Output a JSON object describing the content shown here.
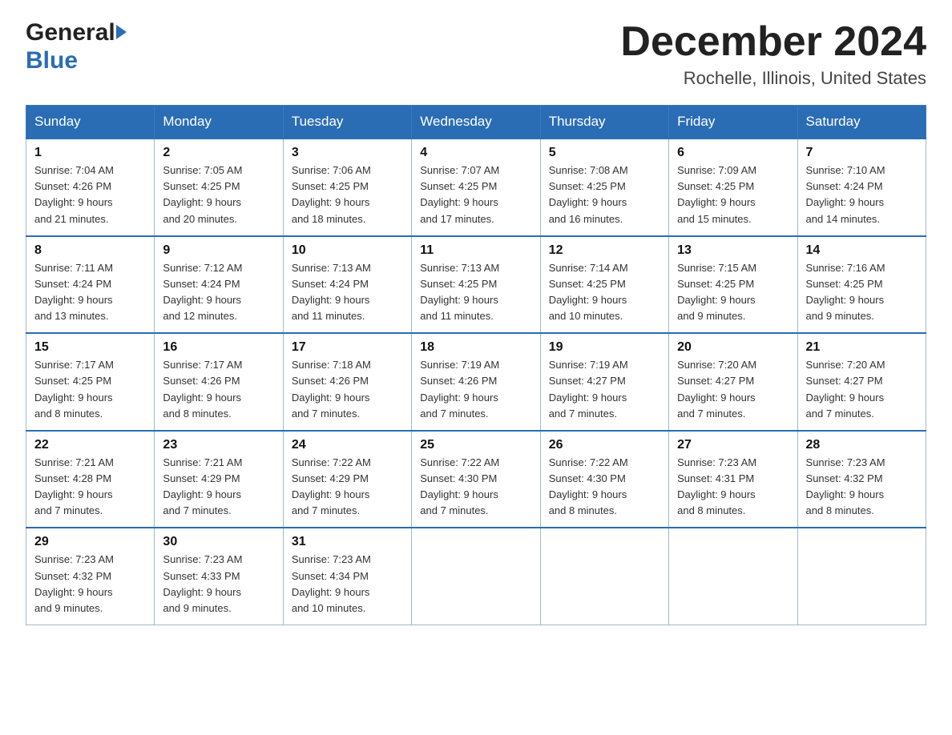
{
  "header": {
    "logo_general": "General",
    "logo_blue": "Blue",
    "month_title": "December 2024",
    "location": "Rochelle, Illinois, United States"
  },
  "days_of_week": [
    "Sunday",
    "Monday",
    "Tuesday",
    "Wednesday",
    "Thursday",
    "Friday",
    "Saturday"
  ],
  "weeks": [
    [
      {
        "day": "1",
        "sunrise": "7:04 AM",
        "sunset": "4:26 PM",
        "daylight": "9 hours and 21 minutes."
      },
      {
        "day": "2",
        "sunrise": "7:05 AM",
        "sunset": "4:25 PM",
        "daylight": "9 hours and 20 minutes."
      },
      {
        "day": "3",
        "sunrise": "7:06 AM",
        "sunset": "4:25 PM",
        "daylight": "9 hours and 18 minutes."
      },
      {
        "day": "4",
        "sunrise": "7:07 AM",
        "sunset": "4:25 PM",
        "daylight": "9 hours and 17 minutes."
      },
      {
        "day": "5",
        "sunrise": "7:08 AM",
        "sunset": "4:25 PM",
        "daylight": "9 hours and 16 minutes."
      },
      {
        "day": "6",
        "sunrise": "7:09 AM",
        "sunset": "4:25 PM",
        "daylight": "9 hours and 15 minutes."
      },
      {
        "day": "7",
        "sunrise": "7:10 AM",
        "sunset": "4:24 PM",
        "daylight": "9 hours and 14 minutes."
      }
    ],
    [
      {
        "day": "8",
        "sunrise": "7:11 AM",
        "sunset": "4:24 PM",
        "daylight": "9 hours and 13 minutes."
      },
      {
        "day": "9",
        "sunrise": "7:12 AM",
        "sunset": "4:24 PM",
        "daylight": "9 hours and 12 minutes."
      },
      {
        "day": "10",
        "sunrise": "7:13 AM",
        "sunset": "4:24 PM",
        "daylight": "9 hours and 11 minutes."
      },
      {
        "day": "11",
        "sunrise": "7:13 AM",
        "sunset": "4:25 PM",
        "daylight": "9 hours and 11 minutes."
      },
      {
        "day": "12",
        "sunrise": "7:14 AM",
        "sunset": "4:25 PM",
        "daylight": "9 hours and 10 minutes."
      },
      {
        "day": "13",
        "sunrise": "7:15 AM",
        "sunset": "4:25 PM",
        "daylight": "9 hours and 9 minutes."
      },
      {
        "day": "14",
        "sunrise": "7:16 AM",
        "sunset": "4:25 PM",
        "daylight": "9 hours and 9 minutes."
      }
    ],
    [
      {
        "day": "15",
        "sunrise": "7:17 AM",
        "sunset": "4:25 PM",
        "daylight": "9 hours and 8 minutes."
      },
      {
        "day": "16",
        "sunrise": "7:17 AM",
        "sunset": "4:26 PM",
        "daylight": "9 hours and 8 minutes."
      },
      {
        "day": "17",
        "sunrise": "7:18 AM",
        "sunset": "4:26 PM",
        "daylight": "9 hours and 7 minutes."
      },
      {
        "day": "18",
        "sunrise": "7:19 AM",
        "sunset": "4:26 PM",
        "daylight": "9 hours and 7 minutes."
      },
      {
        "day": "19",
        "sunrise": "7:19 AM",
        "sunset": "4:27 PM",
        "daylight": "9 hours and 7 minutes."
      },
      {
        "day": "20",
        "sunrise": "7:20 AM",
        "sunset": "4:27 PM",
        "daylight": "9 hours and 7 minutes."
      },
      {
        "day": "21",
        "sunrise": "7:20 AM",
        "sunset": "4:27 PM",
        "daylight": "9 hours and 7 minutes."
      }
    ],
    [
      {
        "day": "22",
        "sunrise": "7:21 AM",
        "sunset": "4:28 PM",
        "daylight": "9 hours and 7 minutes."
      },
      {
        "day": "23",
        "sunrise": "7:21 AM",
        "sunset": "4:29 PM",
        "daylight": "9 hours and 7 minutes."
      },
      {
        "day": "24",
        "sunrise": "7:22 AM",
        "sunset": "4:29 PM",
        "daylight": "9 hours and 7 minutes."
      },
      {
        "day": "25",
        "sunrise": "7:22 AM",
        "sunset": "4:30 PM",
        "daylight": "9 hours and 7 minutes."
      },
      {
        "day": "26",
        "sunrise": "7:22 AM",
        "sunset": "4:30 PM",
        "daylight": "9 hours and 8 minutes."
      },
      {
        "day": "27",
        "sunrise": "7:23 AM",
        "sunset": "4:31 PM",
        "daylight": "9 hours and 8 minutes."
      },
      {
        "day": "28",
        "sunrise": "7:23 AM",
        "sunset": "4:32 PM",
        "daylight": "9 hours and 8 minutes."
      }
    ],
    [
      {
        "day": "29",
        "sunrise": "7:23 AM",
        "sunset": "4:32 PM",
        "daylight": "9 hours and 9 minutes."
      },
      {
        "day": "30",
        "sunrise": "7:23 AM",
        "sunset": "4:33 PM",
        "daylight": "9 hours and 9 minutes."
      },
      {
        "day": "31",
        "sunrise": "7:23 AM",
        "sunset": "4:34 PM",
        "daylight": "9 hours and 10 minutes."
      },
      null,
      null,
      null,
      null
    ]
  ],
  "labels": {
    "sunrise": "Sunrise:",
    "sunset": "Sunset:",
    "daylight": "Daylight:"
  }
}
